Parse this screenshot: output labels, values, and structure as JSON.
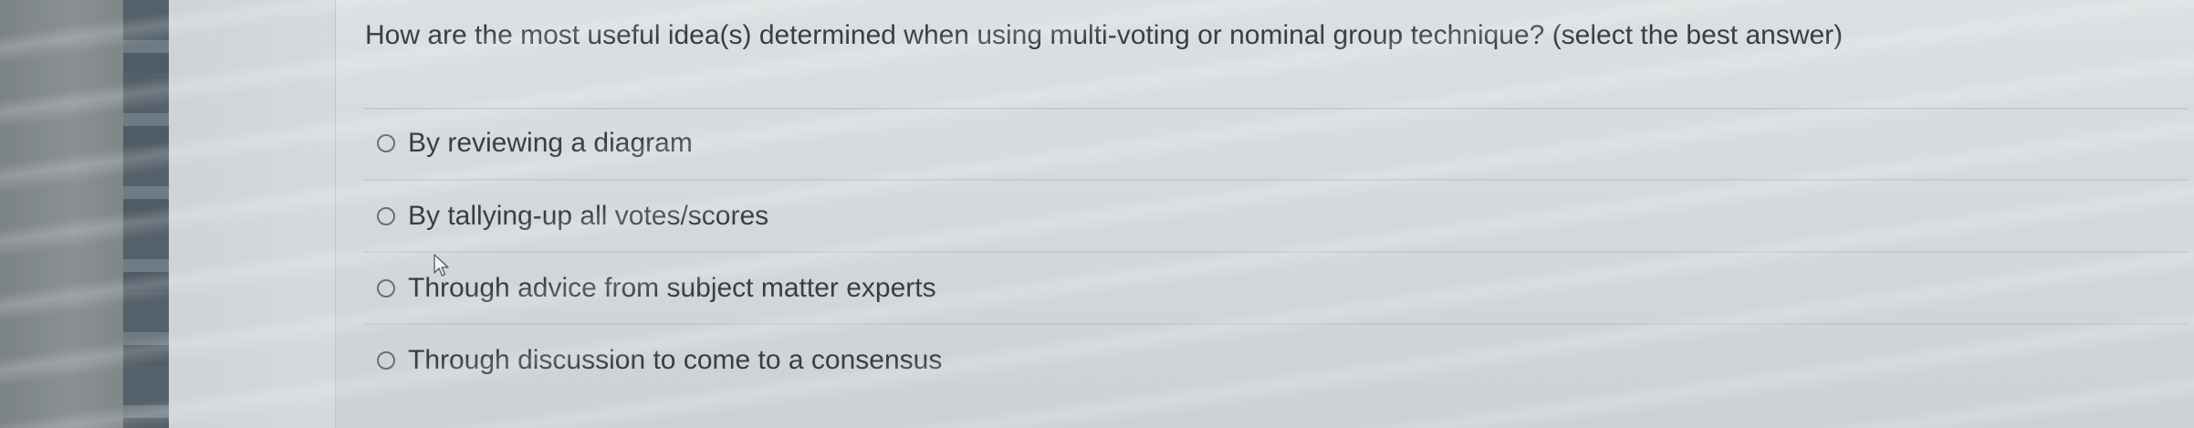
{
  "question": {
    "text": "How are the most useful idea(s) determined when using multi-voting or nominal group technique? (select the best answer)"
  },
  "options": [
    {
      "label": "By reviewing a diagram",
      "selected": false
    },
    {
      "label": "By tallying-up all votes/scores",
      "selected": false
    },
    {
      "label": "Through advice from subject matter experts",
      "selected": false
    },
    {
      "label": "Through discussion to come to a consensus",
      "selected": false
    }
  ]
}
